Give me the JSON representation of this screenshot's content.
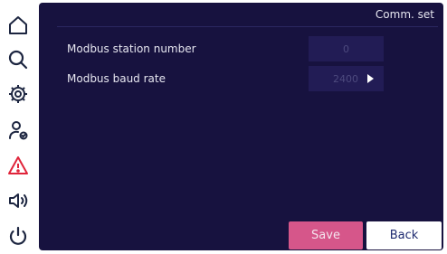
{
  "sidebar": {
    "icons": [
      {
        "name": "home-icon"
      },
      {
        "name": "search-icon"
      },
      {
        "name": "settings-gear-icon"
      },
      {
        "name": "user-check-icon"
      },
      {
        "name": "warning-icon",
        "color": "#e0243a"
      },
      {
        "name": "volume-icon"
      },
      {
        "name": "power-icon"
      }
    ]
  },
  "header": {
    "title": "Comm. set"
  },
  "settings": {
    "station": {
      "label": "Modbus station number",
      "value": "0"
    },
    "baud": {
      "label": "Modbus baud rate",
      "value": "2400"
    }
  },
  "buttons": {
    "save_label": "Save",
    "back_label": "Back"
  },
  "colors": {
    "panel_background": "#17123f",
    "value_box": "#221c55",
    "save_button": "#d6568a",
    "back_button": "#ffffff",
    "warning": "#e0243a"
  }
}
